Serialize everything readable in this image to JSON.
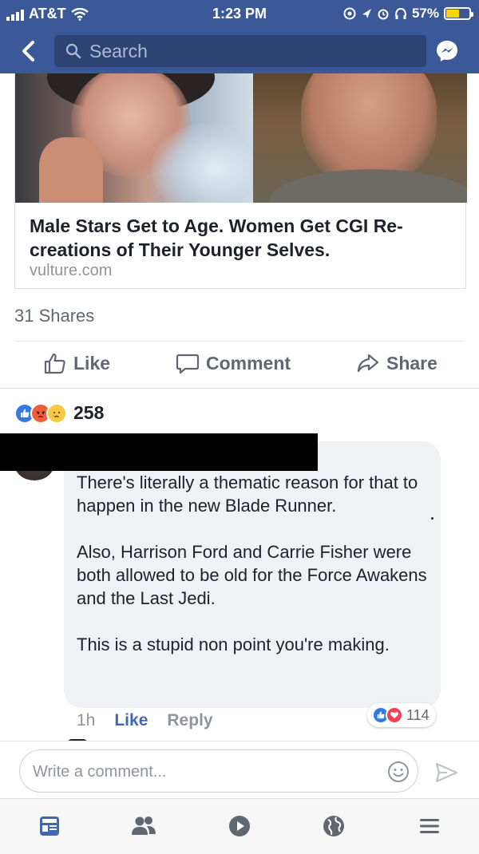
{
  "status_bar": {
    "carrier": "AT&T",
    "time": "1:23 PM",
    "battery": "57%",
    "battery_level": 0.57
  },
  "nav": {
    "search_placeholder": "Search",
    "back_icon": "chevron-left-icon",
    "messenger_icon": "messenger-icon"
  },
  "link_card": {
    "title": "Male Stars Get to Age. Women Get CGI Re-creations of Their Younger Selves.",
    "domain": "vulture.com"
  },
  "post": {
    "shares": "31 Shares",
    "reaction_count": "258",
    "reactions": [
      "like",
      "angry",
      "sad"
    ]
  },
  "actions": {
    "like": "Like",
    "comment": "Comment",
    "share": "Share"
  },
  "comment": {
    "paragraphs": [
      "There's literally a thematic reason for that to happen in the new Blade Runner.",
      "Also, Harrison Ford and Carrie Fisher were both allowed to be old for the Force Awakens and the Last Jedi.",
      "This is a stupid non point you're making."
    ],
    "time": "1h",
    "like_label": "Like",
    "reply_label": "Reply",
    "reaction_count": "114",
    "reactions": [
      "like",
      "love"
    ]
  },
  "composer": {
    "placeholder": "Write a comment..."
  },
  "tab_bar": {
    "tabs": [
      "news-feed",
      "friends",
      "watch",
      "notifications-globe",
      "menu"
    ],
    "active": "news-feed"
  },
  "colors": {
    "brand": "#3b5998",
    "link_blue": "#4267b2",
    "active_tab": "#4267b2",
    "inactive_tab": "#606770"
  }
}
